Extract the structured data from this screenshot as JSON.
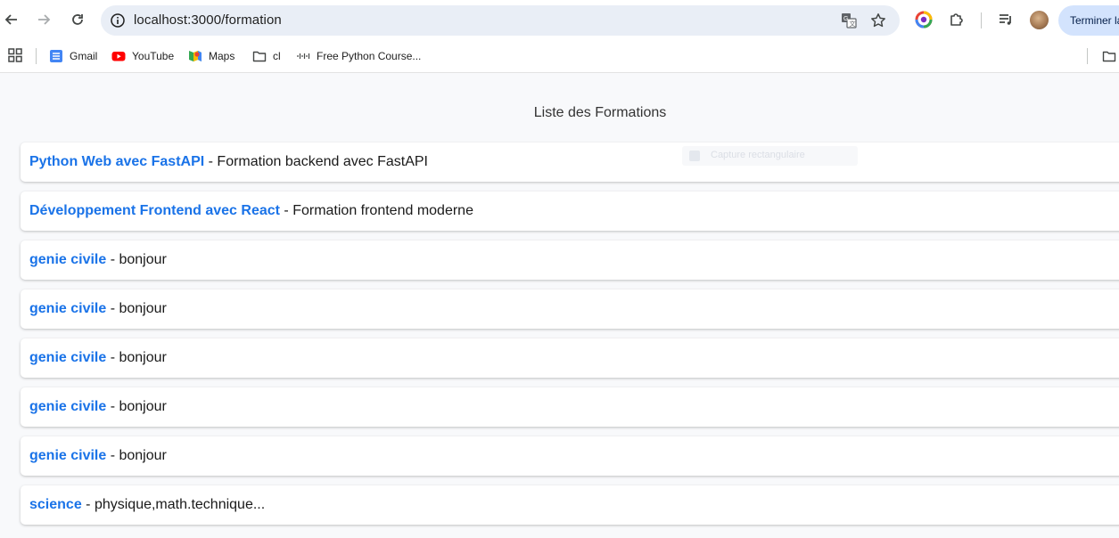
{
  "browser": {
    "url": "localhost:3000/formation",
    "profile_button_label": "Terminer la"
  },
  "bookmarks": [
    {
      "label": "Gmail",
      "icon": "gmail-icon"
    },
    {
      "label": "YouTube",
      "icon": "youtube-icon"
    },
    {
      "label": "Maps",
      "icon": "maps-icon"
    },
    {
      "label": "cl",
      "icon": "folder-icon"
    },
    {
      "label": "Free Python Course...",
      "icon": "cisco-icon"
    }
  ],
  "page": {
    "title": "Liste des Formations",
    "overlay_text": "Capture rectangulaire",
    "separator": " - ",
    "formations": [
      {
        "name": "Python Web avec FastAPI",
        "description": "Formation backend avec FastAPI"
      },
      {
        "name": "Développement Frontend avec React",
        "description": "Formation frontend moderne"
      },
      {
        "name": "genie civile",
        "description": "bonjour"
      },
      {
        "name": "genie civile",
        "description": "bonjour"
      },
      {
        "name": "genie civile",
        "description": "bonjour"
      },
      {
        "name": "genie civile",
        "description": "bonjour"
      },
      {
        "name": "genie civile",
        "description": "bonjour"
      },
      {
        "name": "science",
        "description": "physique,math.technique..."
      }
    ]
  },
  "colors": {
    "link": "#1a73e8",
    "background": "#f8f9fb",
    "omnibox": "#e9eef6",
    "profile_button": "#d3e3fd"
  }
}
